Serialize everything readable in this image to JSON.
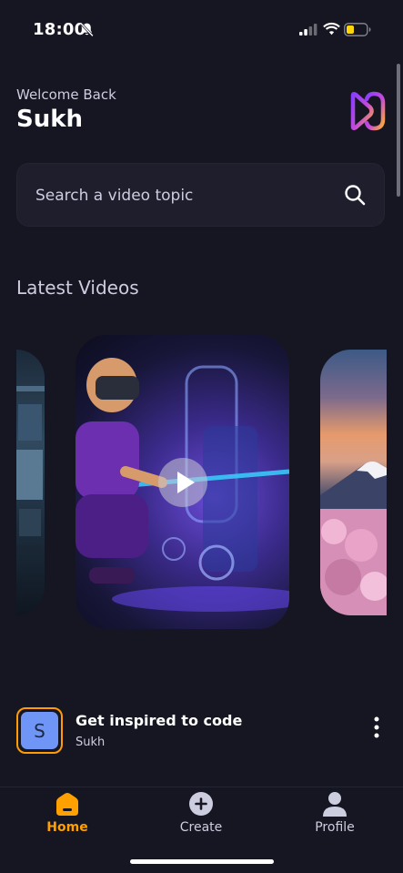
{
  "status_bar": {
    "time": "18:00",
    "icons": [
      "bell-slash-icon",
      "signal-icon",
      "wifi-icon",
      "battery-icon"
    ]
  },
  "header": {
    "welcome_text": "Welcome Back",
    "username": "Sukh",
    "logo_icon": "app-logo-icon"
  },
  "search": {
    "placeholder": "Search a video topic",
    "icon": "search-icon"
  },
  "latest_videos": {
    "title": "Latest Videos",
    "cards": [
      "city-thumbnail",
      "vr-coder-thumbnail",
      "mount-fuji-thumbnail"
    ]
  },
  "post": {
    "avatar_letter": "S",
    "title": "Get inspired to code",
    "creator": "Sukh"
  },
  "tabs": [
    {
      "label": "Home",
      "icon": "home-icon",
      "active": true
    },
    {
      "label": "Create",
      "icon": "plus-circle-icon",
      "active": false
    },
    {
      "label": "Profile",
      "icon": "profile-icon",
      "active": false
    }
  ],
  "colors": {
    "background": "#161622",
    "accent": "#FFA001",
    "surface": "#1e1e2d",
    "muted_text": "#cdcde0"
  }
}
